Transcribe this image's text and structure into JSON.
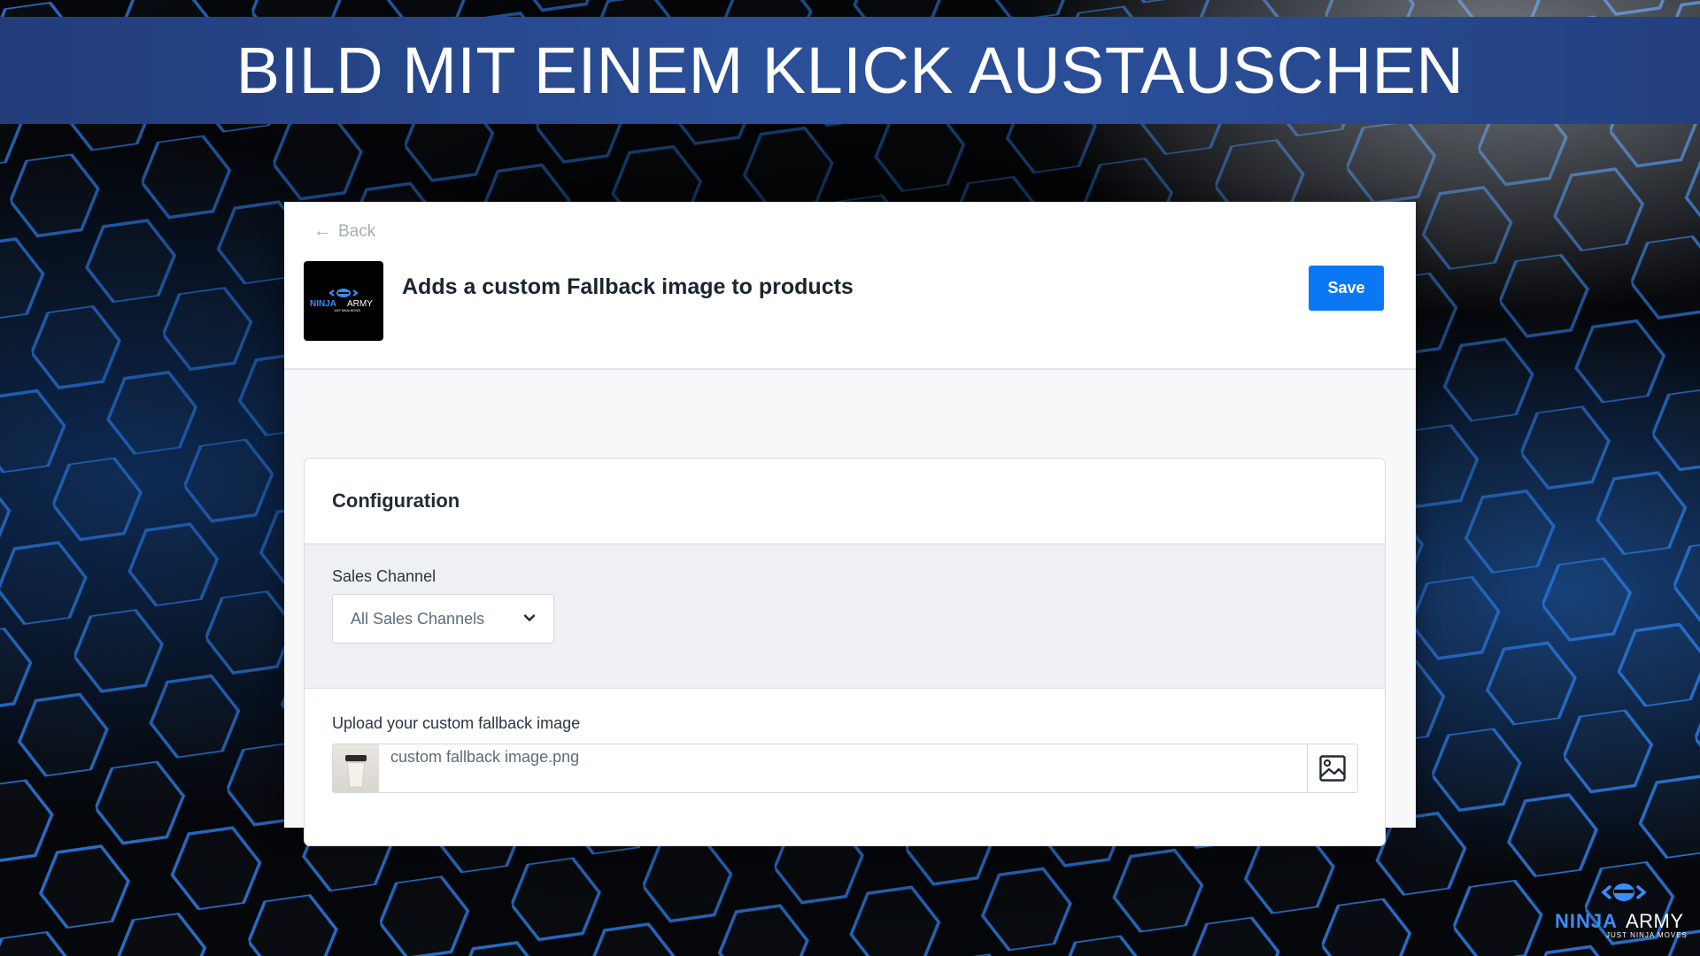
{
  "banner": {
    "title": "BILD MIT EINEM KLICK AUSTAUSCHEN"
  },
  "header": {
    "back_label": "Back",
    "back_icon": "arrow-left-icon",
    "app_logo": {
      "ninja": "NINJA",
      "army": "ARMY",
      "tagline": "JUST NINJA MOVES"
    },
    "title": "Adds a custom Fallback image to products",
    "save_label": "Save"
  },
  "configuration": {
    "title": "Configuration",
    "sales_channel": {
      "label": "Sales Channel",
      "selected": "All Sales Channels",
      "icon": "chevron-down-icon"
    },
    "upload": {
      "label": "Upload your custom fallback image",
      "file_name": "custom fallback image.png",
      "thumbnail": "coffee-cup-thumbnail",
      "media_icon": "image-icon"
    }
  },
  "brand": {
    "ninja": "NINJA",
    "army": "ARMY",
    "tagline": "JUST NINJA MOVES"
  },
  "colors": {
    "banner": "#2b4f99",
    "primary_button": "#0a78f5",
    "brand_blue": "#3a8cff",
    "background": "#07090d"
  }
}
